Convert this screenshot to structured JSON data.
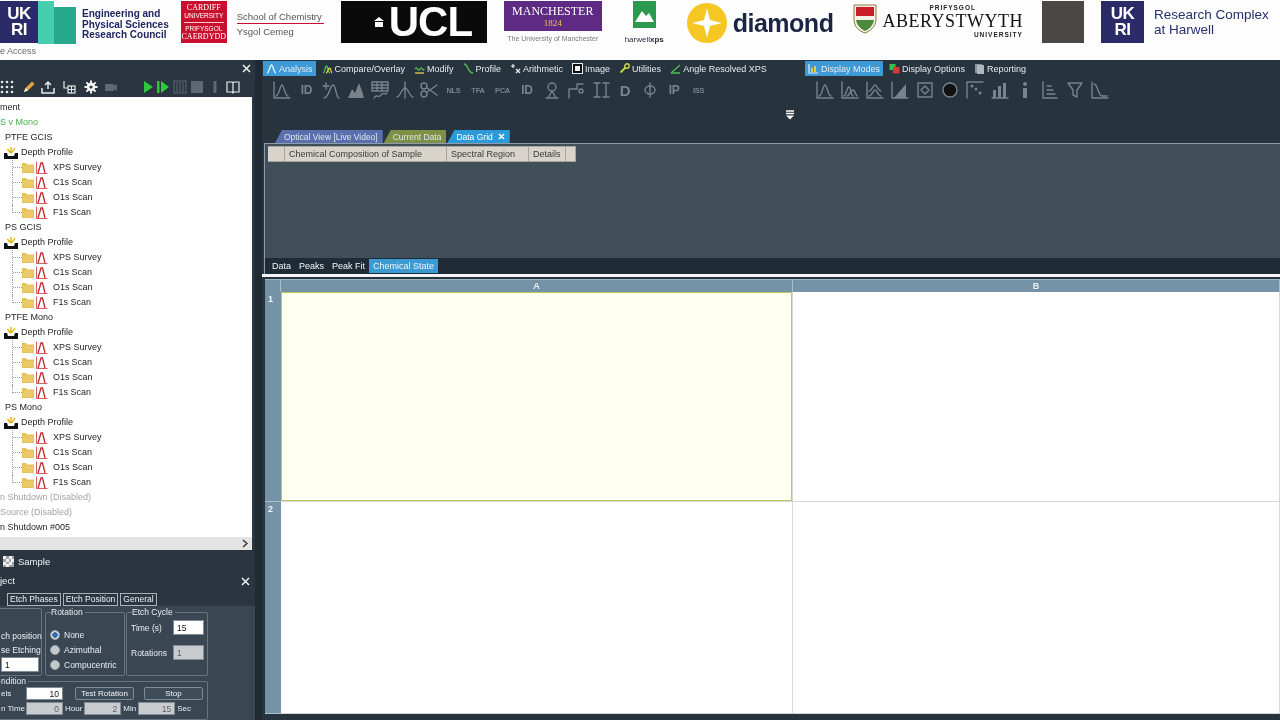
{
  "banner": {
    "logos": [
      {
        "kind": "ukri",
        "lines": [
          "UK",
          "RI"
        ]
      },
      {
        "kind": "epsrc",
        "lines": [
          "Engineering and",
          "Physical Sciences",
          "Research Council"
        ]
      },
      {
        "kind": "cardiff",
        "top": [
          "CARDIFF",
          "UNIVERSITY"
        ],
        "bottom": [
          "PRIFYSGOL",
          "CAERDYDD"
        ]
      },
      {
        "kind": "department",
        "lines": [
          "School of Chemistry",
          "Ysgol Cemeg"
        ]
      },
      {
        "kind": "ucl",
        "text": "UCL"
      },
      {
        "kind": "manchester",
        "name": "MANCHESTER",
        "year": "1824",
        "caption": "The University of Manchester"
      },
      {
        "kind": "harwellxps",
        "text": "harwell**xps**"
      },
      {
        "kind": "diamond",
        "text": "diamond"
      },
      {
        "kind": "aberystwyth",
        "top": "PRIFYSGOL",
        "name": "ABERYSTWYTH",
        "bottom": "UNIVERSITY"
      },
      {
        "kind": "plain"
      },
      {
        "kind": "ukri",
        "lines": [
          "UK",
          "RI"
        ]
      },
      {
        "kind": "rcah",
        "lines": [
          "Research Complex",
          "at Harwell"
        ]
      }
    ],
    "caption": "e Access"
  },
  "left_panel": {
    "toolbar": [
      {
        "disabled": false
      },
      {
        "disabled": false
      },
      {
        "disabled": false
      },
      {
        "disabled": false
      },
      {
        "disabled": false
      },
      {
        "disabled": true
      },
      {
        "disabled": false
      },
      {
        "disabled": false
      },
      {
        "disabled": true
      },
      {
        "disabled": true
      },
      {
        "disabled": true
      },
      {
        "disabled": false
      }
    ],
    "tree": [
      {
        "label": "ment",
        "active": false,
        "disabled": false
      },
      {
        "label": "S v Mono",
        "active": true,
        "disabled": false,
        "children": [
          {
            "kind": "sample",
            "label": "PTFE GCIS",
            "children": [
              {
                "kind": "profile",
                "label": "Depth Profile",
                "children": [
                  {
                    "kind": "scan",
                    "label": "XPS Survey"
                  },
                  {
                    "kind": "scan",
                    "label": "C1s Scan"
                  },
                  {
                    "kind": "scan",
                    "label": "O1s Scan"
                  },
                  {
                    "kind": "scan",
                    "label": "F1s Scan"
                  }
                ]
              }
            ]
          },
          {
            "kind": "sample",
            "label": "PS GCIS",
            "children": [
              {
                "kind": "profile",
                "label": "Depth Profile",
                "children": [
                  {
                    "kind": "scan",
                    "label": "XPS Survey"
                  },
                  {
                    "kind": "scan",
                    "label": "C1s Scan"
                  },
                  {
                    "kind": "scan",
                    "label": "O1s Scan"
                  },
                  {
                    "kind": "scan",
                    "label": "F1s Scan"
                  }
                ]
              }
            ]
          },
          {
            "kind": "sample",
            "label": "PTFE Mono",
            "children": [
              {
                "kind": "profile",
                "label": "Depth Profile",
                "children": [
                  {
                    "kind": "scan",
                    "label": "XPS Survey"
                  },
                  {
                    "kind": "scan",
                    "label": "C1s Scan"
                  },
                  {
                    "kind": "scan",
                    "label": "O1s Scan"
                  },
                  {
                    "kind": "scan",
                    "label": "F1s Scan"
                  }
                ]
              }
            ]
          },
          {
            "kind": "sample",
            "label": "PS Mono",
            "children": [
              {
                "kind": "profile",
                "label": "Depth Profile",
                "children": [
                  {
                    "kind": "scan",
                    "label": "XPS Survey"
                  },
                  {
                    "kind": "scan",
                    "label": "C1s Scan"
                  },
                  {
                    "kind": "scan",
                    "label": "O1s Scan"
                  },
                  {
                    "kind": "scan",
                    "label": "F1s Scan"
                  }
                ]
              }
            ]
          }
        ]
      },
      {
        "label": "n Shutdown (Disabled)",
        "active": false,
        "disabled": true
      },
      {
        "label": "Source (Disabled)",
        "active": false,
        "disabled": true
      },
      {
        "label": "n Shutdown #005",
        "active": false,
        "disabled": false
      }
    ],
    "sample_bar": {
      "label": "Sample"
    },
    "object_panel": {
      "title": "ject",
      "tabs": [
        {
          "label": "Etch Phases",
          "selected": false
        },
        {
          "label": "Etch Position",
          "selected": false
        },
        {
          "label": "General",
          "selected": false
        }
      ],
      "position_group": {
        "labels": [
          "ch position",
          "se Etching"
        ],
        "value": "1"
      },
      "rotation": {
        "title": "Rotation",
        "options": [
          {
            "label": "None",
            "selected": true
          },
          {
            "label": "Azimuthal",
            "selected": false
          },
          {
            "label": "Compucentric",
            "selected": false
          }
        ]
      },
      "etch_cycle": {
        "title": "Etch Cycle",
        "fields": [
          {
            "label": "Time (s)",
            "value": "15",
            "disabled": false
          },
          {
            "label": "Rotations",
            "value": "1",
            "disabled": true
          }
        ]
      },
      "condition": {
        "title": "ndition",
        "label": "els",
        "value": "10",
        "buttons": [
          "Test Rotation",
          "Stop"
        ],
        "time": {
          "label": "n Time",
          "parts": [
            {
              "value": "0",
              "unit": "Hour",
              "disabled": true
            },
            {
              "value": "2",
              "unit": "Min",
              "disabled": true
            },
            {
              "value": "15",
              "unit": "Sec",
              "disabled": true
            }
          ]
        }
      }
    }
  },
  "ribbon": {
    "groups": [
      {
        "tabs": [
          {
            "label": "Analysis",
            "selected": true
          },
          {
            "label": "Compare/Overlay",
            "selected": false
          },
          {
            "label": "Modify",
            "selected": false
          },
          {
            "label": "Profile",
            "selected": false
          },
          {
            "label": "Arithmetic",
            "selected": false
          },
          {
            "label": "Image",
            "selected": false
          },
          {
            "label": "Utilities",
            "selected": false
          },
          {
            "label": "Angle Resolved XPS",
            "selected": false
          }
        ],
        "tools": [
          {
            "kind": "icon"
          },
          {
            "kind": "text",
            "label": "ID"
          },
          {
            "kind": "icon"
          },
          {
            "kind": "icon"
          },
          {
            "kind": "icon"
          },
          {
            "kind": "icon"
          },
          {
            "kind": "icon"
          },
          {
            "kind": "text",
            "label": "NLS"
          },
          {
            "kind": "text",
            "label": "TFA"
          },
          {
            "kind": "text",
            "label": "PCA"
          },
          {
            "kind": "text",
            "label": "ID"
          },
          {
            "kind": "icon"
          },
          {
            "kind": "icon"
          },
          {
            "kind": "icon"
          },
          {
            "kind": "text",
            "label": "D"
          },
          {
            "kind": "icon"
          },
          {
            "kind": "text",
            "label": "IP"
          },
          {
            "kind": "text",
            "label": "ISS"
          }
        ]
      },
      {
        "tabs": [
          {
            "label": "Display Modes",
            "selected": true
          },
          {
            "label": "Display Options",
            "selected": false
          },
          {
            "label": "Reporting",
            "selected": false
          }
        ],
        "tools": [
          {
            "kind": "icon"
          },
          {
            "kind": "icon"
          },
          {
            "kind": "icon"
          },
          {
            "kind": "icon"
          },
          {
            "kind": "icon"
          },
          {
            "kind": "icon"
          },
          {
            "kind": "icon"
          },
          {
            "kind": "icon"
          },
          {
            "kind": "icon"
          },
          {
            "kind": "icon"
          },
          {
            "kind": "icon"
          },
          {
            "kind": "icon"
          }
        ]
      }
    ]
  },
  "document_tabs": [
    {
      "label": "Optical View [Live Video]",
      "color": "#5a6fae",
      "selected": false
    },
    {
      "label": "Current Data",
      "color": "#7f9046",
      "selected": false
    },
    {
      "label": "Data Grid",
      "color": "#2c9ad8",
      "selected": true
    }
  ],
  "composition_table": {
    "columns": [
      "Chemical Composition of Sample",
      "Spectral Region",
      "Details"
    ]
  },
  "view_tabs": [
    {
      "label": "Data",
      "selected": false
    },
    {
      "label": "Peaks",
      "selected": false
    },
    {
      "label": "Peak Fit",
      "selected": false
    },
    {
      "label": "Chemical State",
      "selected": true
    }
  ],
  "grid": {
    "columns": [
      "A",
      "B"
    ],
    "rows": [
      {
        "label": "1",
        "cells": [
          {
            "selected": true
          },
          {
            "selected": false
          }
        ]
      },
      {
        "label": "2",
        "cells": [
          {
            "selected": false
          },
          {
            "selected": false
          }
        ]
      }
    ]
  }
}
